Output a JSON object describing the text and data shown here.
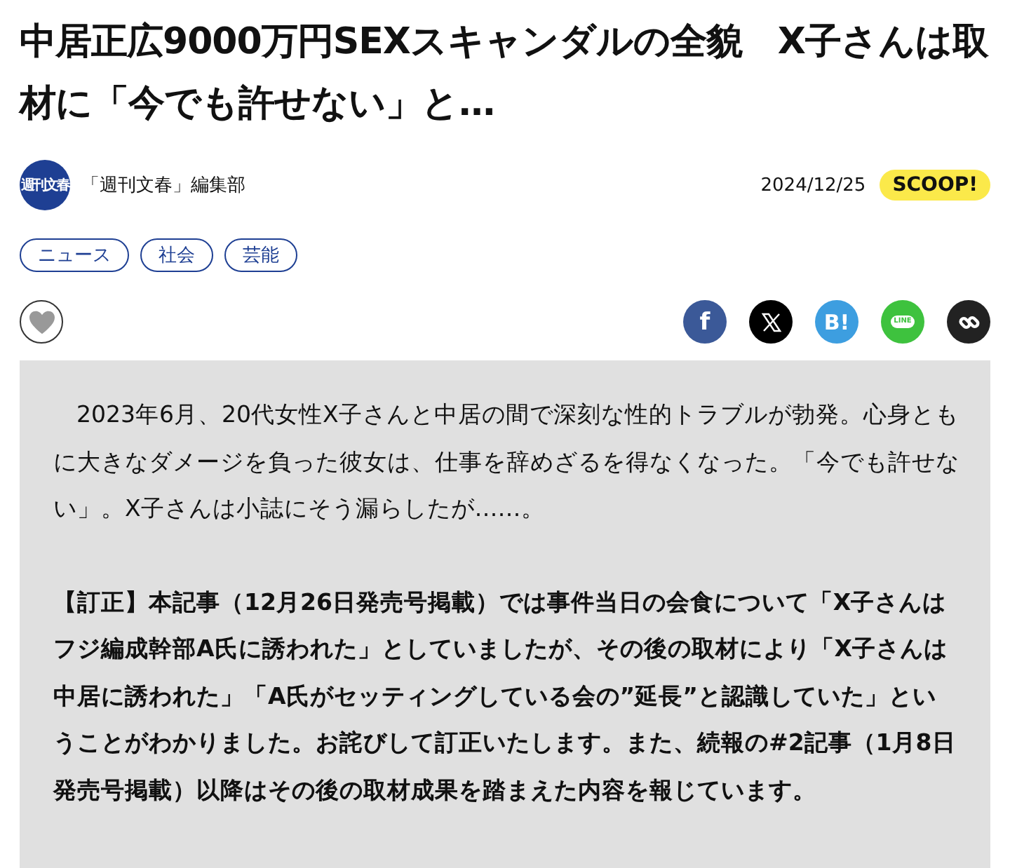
{
  "article": {
    "title": "中居正広9000万円SEXスキャンダルの全貌　X子さんは取材に「今でも許せない」と…"
  },
  "byline": {
    "logo_text": "週刊文春",
    "author": "「週刊文春」編集部",
    "date": "2024/12/25",
    "badge": "SCOOP!"
  },
  "tags": [
    "ニュース",
    "社会",
    "芸能"
  ],
  "share_buttons": [
    {
      "kind": "facebook",
      "label": "f"
    },
    {
      "kind": "x"
    },
    {
      "kind": "hatena",
      "label": "B!"
    },
    {
      "kind": "line",
      "label": "LINE"
    },
    {
      "kind": "link"
    }
  ],
  "body": [
    {
      "kind": "lead",
      "text": "2023年6月、20代女性X子さんと中居の間で深刻な性的トラブルが勃発。心身ともに大きなダメージを負った彼女は、仕事を辞めざるを得なくなった。「今でも許せない」。X子さんは小誌にそう漏らしたが……。"
    },
    {
      "kind": "correction",
      "text": "【訂正】本記事（12月26日発売号掲載）では事件当日の会食について「X子さんはフジ編成幹部A氏に誘われた」としていましたが、その後の取材により「X子さんは中居に誘われた」「A氏がセッティングしている会の”延長”と認識していた」ということがわかりました。お詫びして訂正いたします。また、続報の#2記事（1月8日発売号掲載）以降はその後の取材成果を踏まえた内容を報じています。"
    }
  ]
}
